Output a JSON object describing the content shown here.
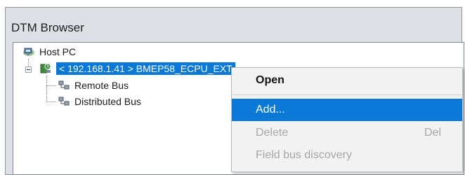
{
  "window": {
    "title": "DTM Browser"
  },
  "tree": {
    "root": {
      "label": "Host PC",
      "icon": "host-pc-icon"
    },
    "selected": {
      "label": "< 192.168.1.41 > BMEP58_ECPU_EXT",
      "icon": "plc-module-icon"
    },
    "children": [
      {
        "label": "Remote Bus",
        "icon": "network-bus-icon"
      },
      {
        "label": "Distributed Bus",
        "icon": "network-bus-icon"
      }
    ]
  },
  "context_menu": {
    "items": [
      {
        "label": "Open",
        "shortcut": "",
        "state": "default-bold"
      },
      {
        "label": "Add...",
        "shortcut": "",
        "state": "highlighted"
      },
      {
        "label": "Delete",
        "shortcut": "Del",
        "state": "disabled"
      },
      {
        "label": "Field bus discovery",
        "shortcut": "",
        "state": "disabled"
      }
    ]
  },
  "colors": {
    "selection": "#0a78d7",
    "window_bg": "#dde1e6",
    "menu_bg": "#f2f2f2"
  }
}
